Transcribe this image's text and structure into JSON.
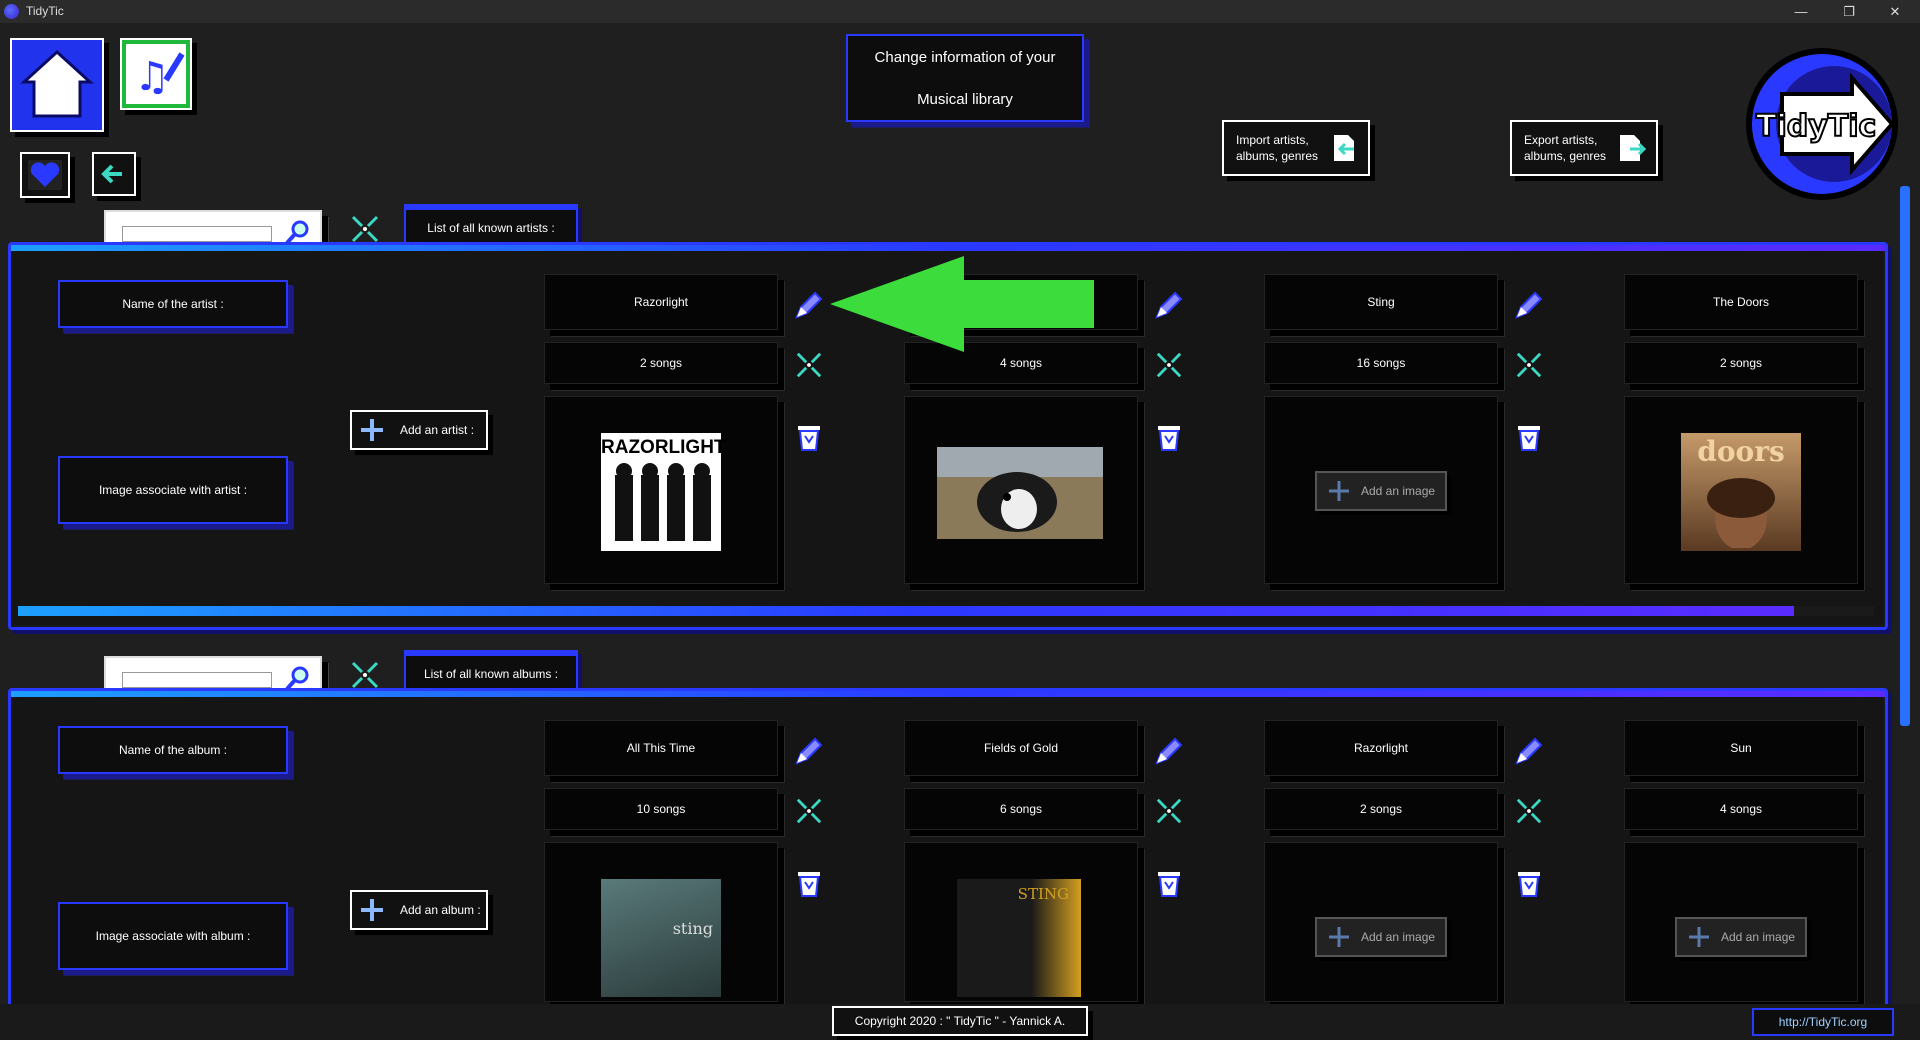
{
  "window": {
    "title": "TidyTic",
    "min": "—",
    "restore": "❐",
    "close": "✕"
  },
  "header": {
    "title_line1": "Change information of your",
    "title_line2": "Musical library",
    "import_label_line1": "Import artists,",
    "import_label_line2": "albums, genres",
    "export_label_line1": "Export artists,",
    "export_label_line2": "albums, genres",
    "brand": "TidyTic"
  },
  "artists": {
    "tab_label": "List of all known artists :",
    "name_label": "Name of the artist :",
    "image_label": "Image associate with artist :",
    "add_button": "Add an artist :",
    "items": [
      {
        "name": "Razorlight",
        "songs": "2 songs",
        "image": "razorlight-photo",
        "image_text": "RAZORLIGHT"
      },
      {
        "name": "",
        "songs": "4 songs",
        "image": "dog-photo"
      },
      {
        "name": "Sting",
        "songs": "16 songs",
        "image": "none",
        "add_image": "Add an image"
      },
      {
        "name": "The Doors",
        "songs": "2 songs",
        "image": "doors-cover",
        "image_text": "doors"
      }
    ]
  },
  "albums": {
    "tab_label": "List of all known albums :",
    "name_label": "Name of the album :",
    "image_label": "Image associate with album :",
    "add_button": "Add an album :",
    "items": [
      {
        "name": "All This Time",
        "songs": "10 songs",
        "image": "all-this-time-cover",
        "image_text": "sting"
      },
      {
        "name": "Fields of Gold",
        "songs": "6 songs",
        "image": "fields-of-gold-cover",
        "image_text": "STING"
      },
      {
        "name": "Razorlight",
        "songs": "2 songs",
        "image": "none",
        "add_image": "Add an image"
      },
      {
        "name": "Sun",
        "songs": "4 songs",
        "image": "none",
        "add_image": "Add an image"
      }
    ]
  },
  "footer": {
    "copyright": "Copyright 2020 : \" TidyTic \" - Yannick A.",
    "link": "http://TidyTic.org"
  },
  "colors": {
    "accent": "#2a39ff",
    "green_arrow": "#3bdc3b",
    "background": "#1f1f1f"
  }
}
